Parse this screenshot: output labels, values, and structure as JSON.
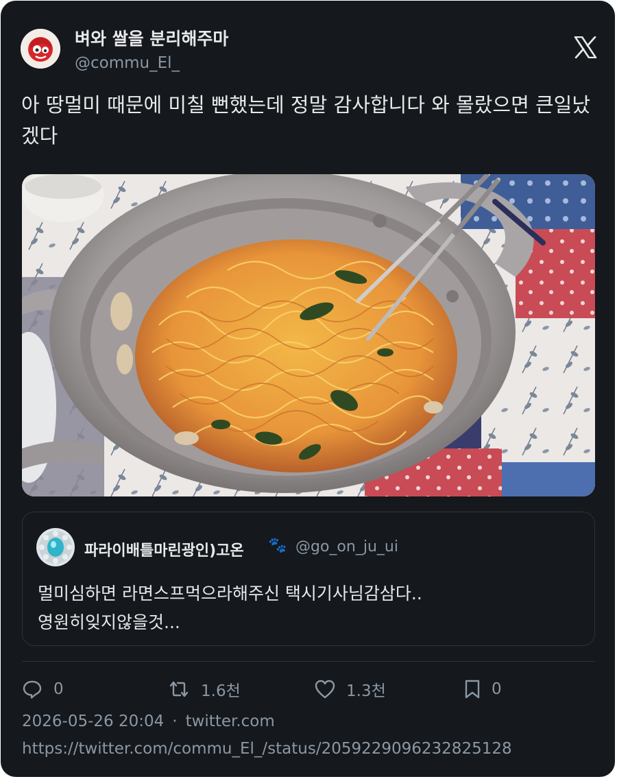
{
  "author": {
    "display_name": "벼와 쌀을 분리해주마",
    "handle": "@commu_El_"
  },
  "tweet": {
    "text": "아 땅멀미 때문에 미칠 뻔했는데 정말 감사합니다 와 몰랐으면 큰일났겠다"
  },
  "quoted_tweet": {
    "display_name": "파라이배틀마린광인)고온",
    "emoji": "🐾",
    "handle": "@go_on_ju_ui",
    "line1": "멀미심하면 라면스프먹으라해주신 택시기사님감삼다..",
    "line2": "영원히잊지않을것..."
  },
  "actions": {
    "replies": "0",
    "retweets": "1.6천",
    "likes": "1.3천",
    "bookmarks": "0"
  },
  "meta": {
    "timestamp": "2026-05-26 20:04",
    "separator": "·",
    "source": "twitter.com",
    "url": "https://twitter.com/commu_El_/status/2059229096232825128"
  },
  "icons": {
    "brand": "x-logo-icon",
    "reply": "reply-icon",
    "retweet": "retweet-icon",
    "like": "heart-icon",
    "bookmark": "bookmark-icon"
  },
  "colors": {
    "background": "#15181c",
    "text": "#e7e9ea",
    "secondary": "#8b98a5",
    "border": "#2f3336"
  }
}
